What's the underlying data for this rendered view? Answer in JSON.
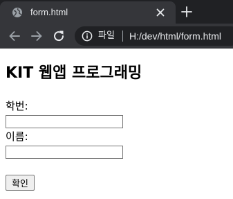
{
  "browser": {
    "tab": {
      "title": "form.html"
    },
    "toolbar": {
      "file_label": "파일",
      "url": "H:/dev/html/form.html"
    }
  },
  "page": {
    "title": "KIT 웹앱 프로그래밍",
    "form": {
      "student_id_label": "학번:",
      "student_id_value": "",
      "name_label": "이름:",
      "name_value": "",
      "submit_label": "확인"
    }
  },
  "colors": {
    "tabstrip_bg": "#202124",
    "tab_active_bg": "#35363a",
    "toolbar_bg": "#35363a",
    "omnibox_bg": "#202124",
    "toolbar_text": "#e8eaed",
    "page_bg": "#ffffff"
  },
  "icons": {
    "favicon": "globe-icon",
    "tab_close": "close-icon",
    "new_tab": "plus-icon",
    "back": "arrow-left-icon",
    "forward": "arrow-right-icon",
    "reload": "reload-icon",
    "site_info": "info-icon"
  }
}
